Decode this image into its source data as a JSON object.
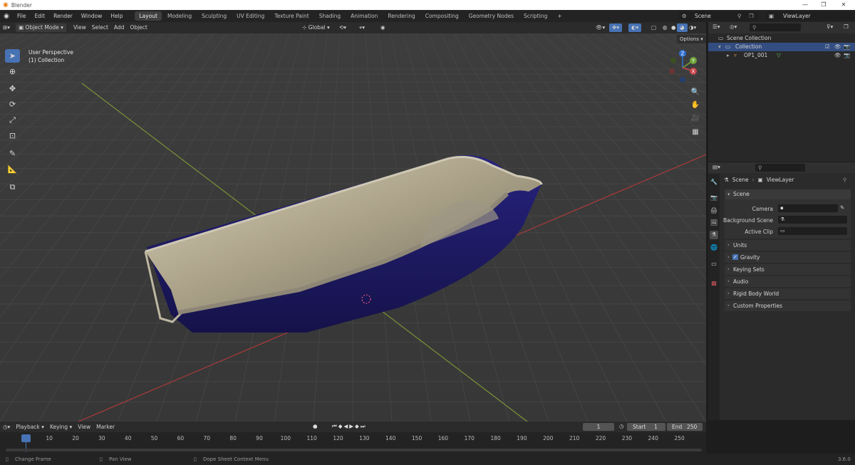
{
  "window": {
    "title": "Blender",
    "min": "—",
    "restore": "❐",
    "close": "✕"
  },
  "menu": [
    "File",
    "Edit",
    "Render",
    "Window",
    "Help"
  ],
  "workspaces": [
    {
      "label": "Layout",
      "active": true
    },
    {
      "label": "Modeling"
    },
    {
      "label": "Sculpting"
    },
    {
      "label": "UV Editing"
    },
    {
      "label": "Texture Paint"
    },
    {
      "label": "Shading"
    },
    {
      "label": "Animation"
    },
    {
      "label": "Rendering"
    },
    {
      "label": "Compositing"
    },
    {
      "label": "Geometry Nodes"
    },
    {
      "label": "Scripting"
    }
  ],
  "add_workspace": "+",
  "scene_selector": "Scene",
  "view_layer_selector": "ViewLayer",
  "viewport_header": {
    "mode": "Object Mode",
    "menus": [
      "View",
      "Select",
      "Add",
      "Object"
    ],
    "orientation": "Global",
    "options": "Options"
  },
  "viewport_overlay": {
    "line1": "User Perspective",
    "line2": "(1) Collection"
  },
  "gizmo": {
    "z": "Z",
    "y": "Y",
    "x": "X"
  },
  "outliner": {
    "rows": [
      {
        "label": "Scene Collection"
      },
      {
        "label": "Collection"
      },
      {
        "label": "OP1_001"
      }
    ]
  },
  "properties": {
    "breadcrumb": [
      "Scene",
      "ViewLayer"
    ],
    "section": "Scene",
    "fields": [
      {
        "label": "Camera"
      },
      {
        "label": "Background Scene"
      },
      {
        "label": "Active Clip"
      }
    ],
    "panels": [
      "Units",
      "Gravity",
      "Keying Sets",
      "Audio",
      "Rigid Body World",
      "Custom Properties"
    ]
  },
  "timeline": {
    "menus": [
      "Playback",
      "Keying",
      "View",
      "Marker"
    ],
    "current_frame": "1",
    "start_label": "Start",
    "start": "1",
    "end_label": "End",
    "end": "250",
    "ticks": [
      "1",
      "10",
      "20",
      "30",
      "40",
      "50",
      "60",
      "70",
      "80",
      "90",
      "100",
      "110",
      "120",
      "130",
      "140",
      "150",
      "160",
      "170",
      "180",
      "190",
      "200",
      "210",
      "220",
      "230",
      "240",
      "250"
    ]
  },
  "status": {
    "item1": "Change Frame",
    "item2": "Pan View",
    "item3": "Dope Sheet Context Menu",
    "version": "3.6.0"
  },
  "colors": {
    "accent": "#4772b3",
    "grid": "#3b3b3b",
    "x_axis": "#c33b3b",
    "y_axis": "#8aa33b",
    "object_outer": "#1f1a6e",
    "object_inner": "#b5ab92"
  }
}
